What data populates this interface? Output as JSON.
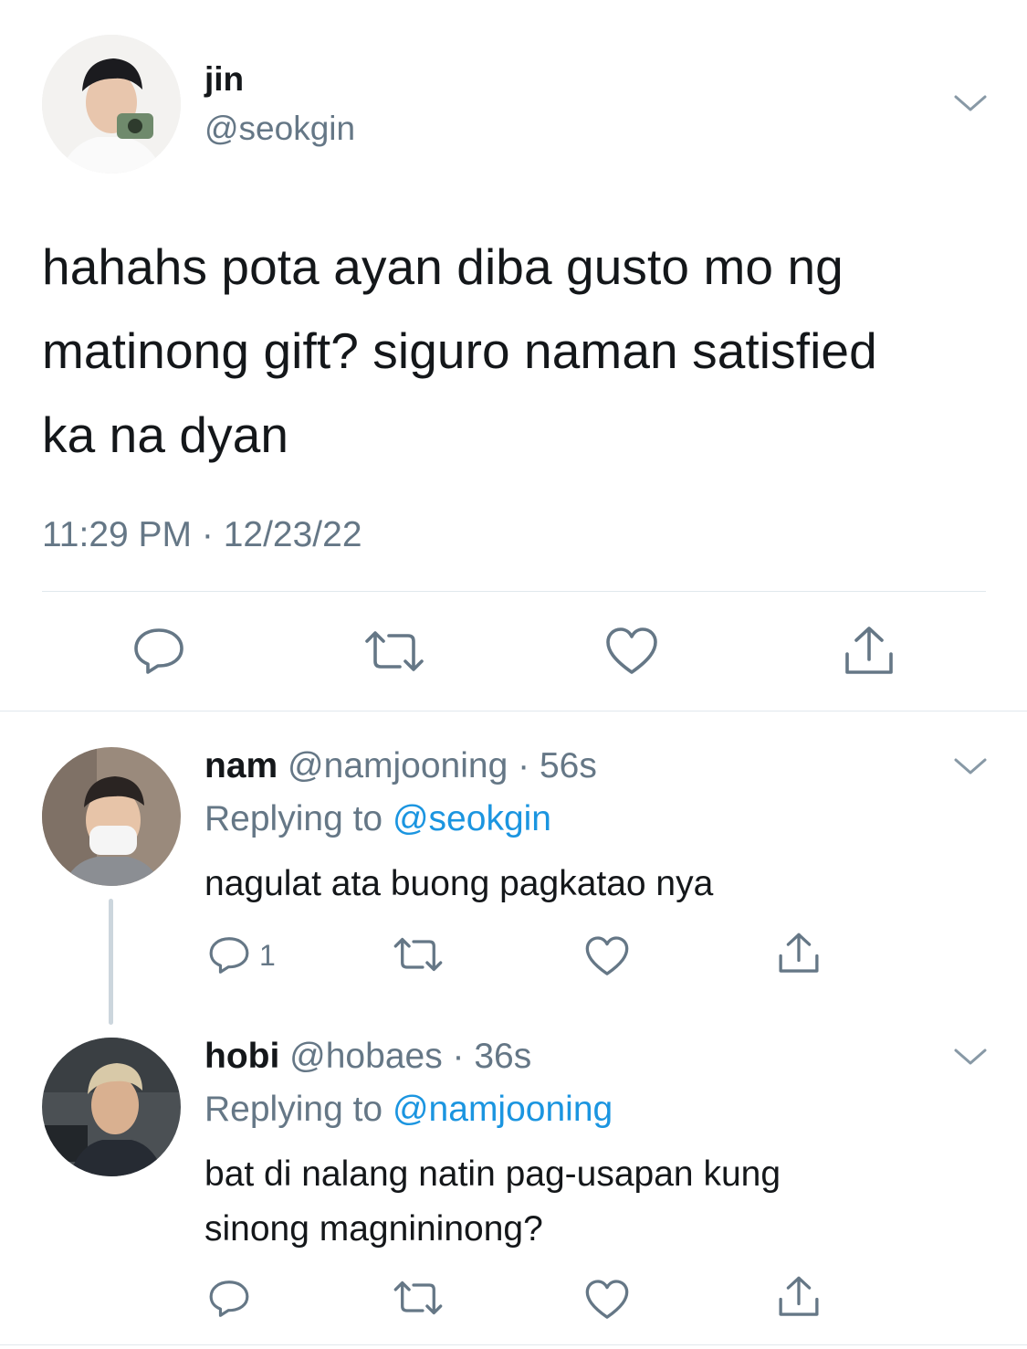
{
  "main_tweet": {
    "author": {
      "name": "jin",
      "handle": "@seokgin"
    },
    "text_lines": [
      "hahahs pota ayan diba gusto mo ng",
      "matinong gift? siguro naman satisfied",
      "ka na dyan"
    ],
    "timestamp": "11:29 PM · 12/23/22"
  },
  "replies": [
    {
      "name": "nam",
      "handle": "@namjooning",
      "time": "· 56s",
      "replying_prefix": "Replying to",
      "replying_to": "@seokgin",
      "text_lines": [
        "nagulat ata buong pagkatao nya"
      ],
      "reply_count": "1"
    },
    {
      "name": "hobi",
      "handle": "@hobaes",
      "time": "· 36s",
      "replying_prefix": "Replying to",
      "replying_to": "@namjooning",
      "text_lines": [
        "bat di nalang natin pag-usapan kung",
        "sinong magnininong?"
      ],
      "reply_count": ""
    }
  ],
  "icons": {
    "reply": "speech-bubble-icon",
    "retweet": "retweet-icon",
    "like": "heart-icon",
    "share": "share-upload-icon",
    "more": "chevron-down-icon"
  },
  "colors": {
    "text": "#14171a",
    "muted": "#657786",
    "link": "#1b95e0",
    "divider": "#e1e8ed",
    "thread_line": "#ccd6dd"
  }
}
